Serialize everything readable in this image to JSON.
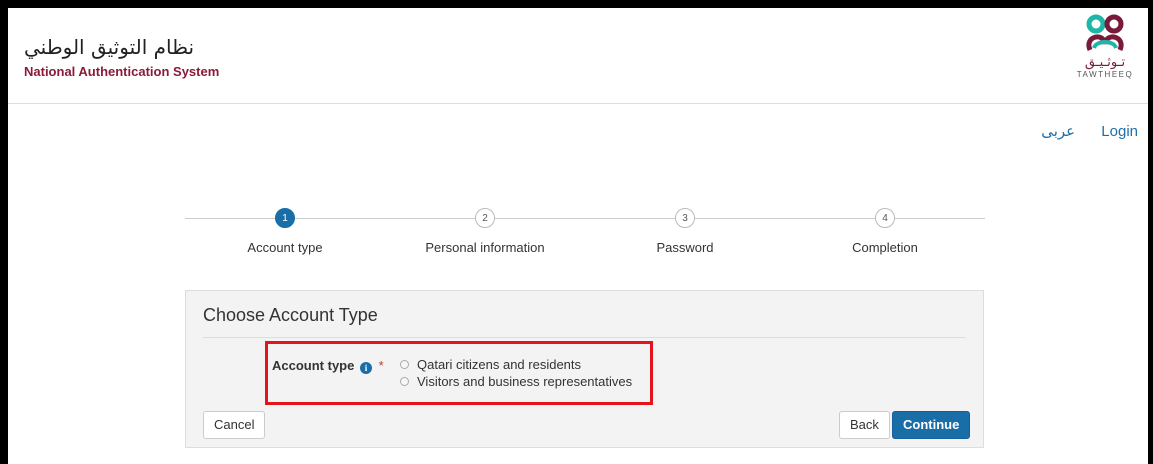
{
  "header": {
    "title_ar": "نظام التوثيق الوطني",
    "title_en": "National Authentication System",
    "logo_ar": "تـوثـيـق",
    "logo_en": "TAWTHEEQ"
  },
  "nav": {
    "lang_label": "عربى",
    "login_label": "Login"
  },
  "steps": [
    {
      "number": "1",
      "label": "Account type",
      "active": true
    },
    {
      "number": "2",
      "label": "Personal information",
      "active": false
    },
    {
      "number": "3",
      "label": "Password",
      "active": false
    },
    {
      "number": "4",
      "label": "Completion",
      "active": false
    }
  ],
  "panel": {
    "title": "Choose Account Type",
    "field_label": "Account type",
    "required_mark": "*",
    "info_glyph": "i",
    "options": [
      {
        "label": "Qatari citizens and residents",
        "selected": false
      },
      {
        "label": "Visitors and business representatives",
        "selected": false
      }
    ],
    "cancel_label": "Cancel",
    "back_label": "Back",
    "continue_label": "Continue"
  },
  "colors": {
    "brand": "#8b1a3a",
    "primary": "#1a6ea8",
    "highlight": "#e3141b"
  }
}
